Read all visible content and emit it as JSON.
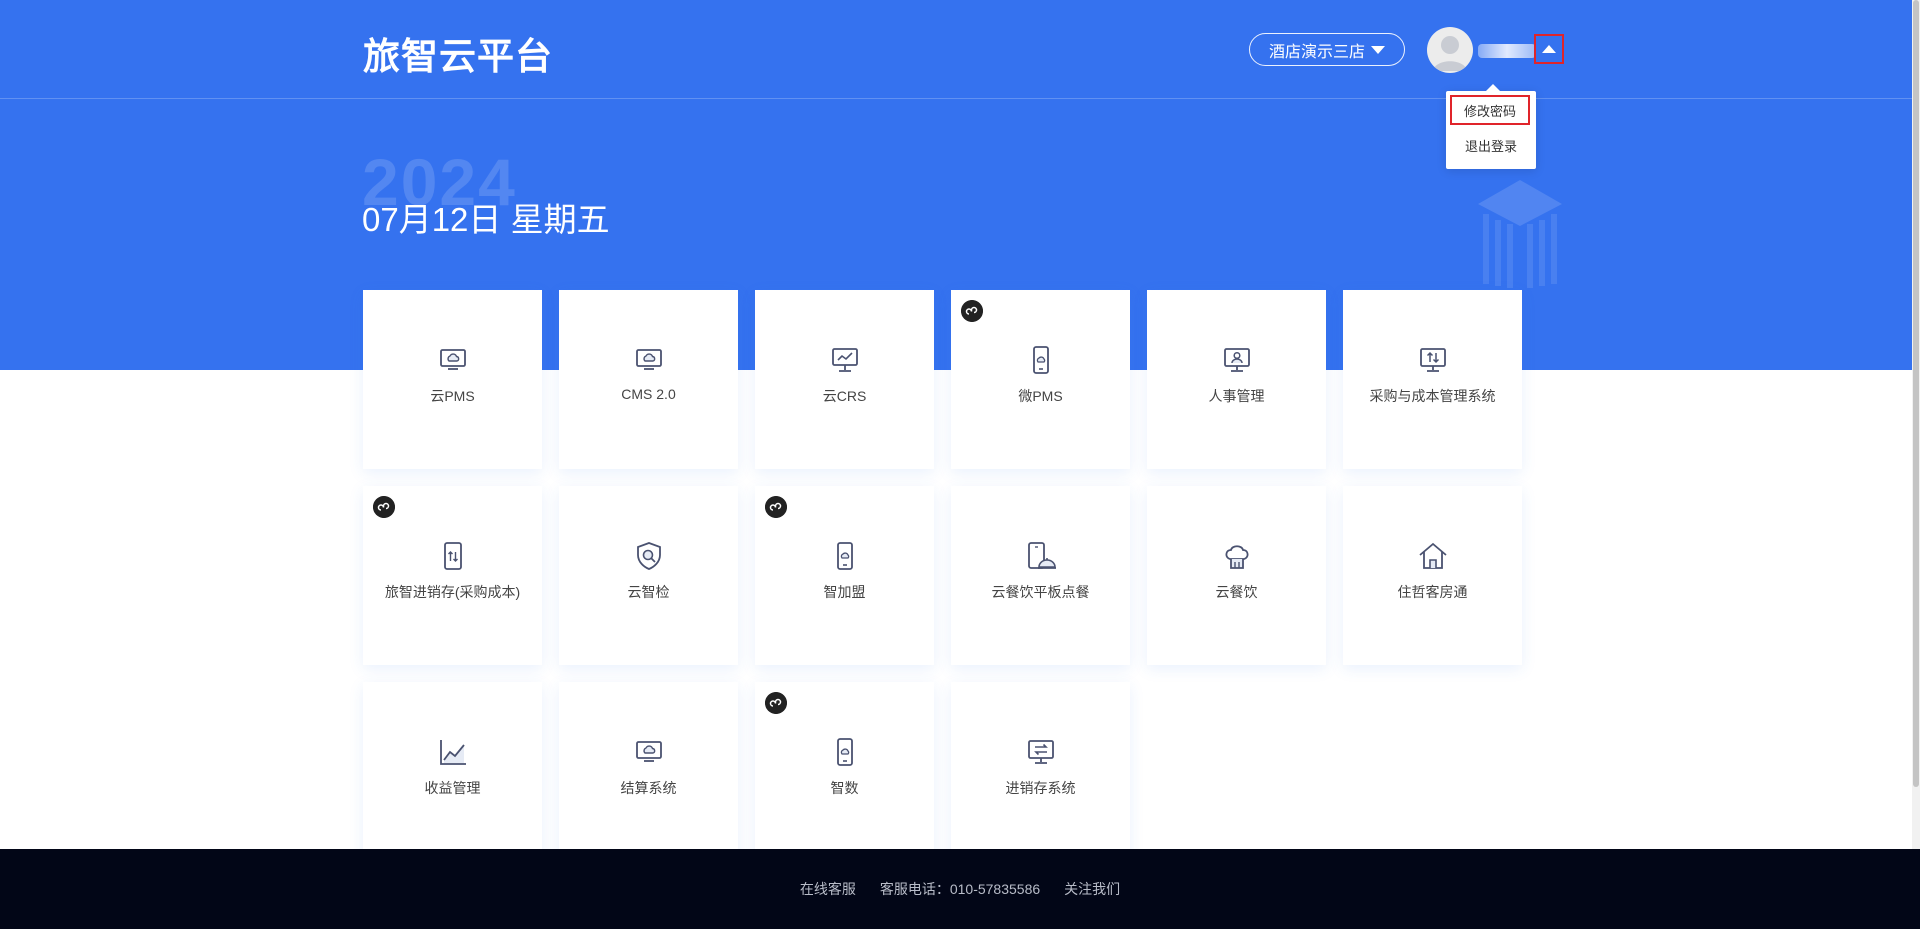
{
  "header": {
    "brand": "旅智云平台",
    "store": "酒店演示三店"
  },
  "user_menu": {
    "items": [
      "修改密码",
      "退出登录"
    ]
  },
  "hero": {
    "year": "2024",
    "date": "07月12日 星期五"
  },
  "apps": [
    {
      "label": "云PMS",
      "icon": "cloud-monitor-icon"
    },
    {
      "label": "CMS 2.0",
      "icon": "cloud-monitor-icon"
    },
    {
      "label": "云CRS",
      "icon": "chart-monitor-icon"
    },
    {
      "label": "微PMS",
      "icon": "cloud-phone-icon",
      "mini_program": true
    },
    {
      "label": "人事管理",
      "icon": "person-monitor-icon"
    },
    {
      "label": "采购与成本管理系统",
      "icon": "transfer-monitor-icon"
    },
    {
      "label": "旅智进销存(采购成本)",
      "icon": "transfer-phone-icon",
      "mini_program": true
    },
    {
      "label": "云智检",
      "icon": "shield-search-icon"
    },
    {
      "label": "智加盟",
      "icon": "cloud-phone-icon",
      "mini_program": true
    },
    {
      "label": "云餐饮平板点餐",
      "icon": "tablet-dish-icon"
    },
    {
      "label": "云餐饮",
      "icon": "chef-hat-icon"
    },
    {
      "label": "住哲客房通",
      "icon": "house-icon"
    },
    {
      "label": "收益管理",
      "icon": "trend-chart-icon"
    },
    {
      "label": "结算系统",
      "icon": "cloud-monitor-icon"
    },
    {
      "label": "智数",
      "icon": "cloud-phone-icon",
      "mini_program": true
    },
    {
      "label": "进销存系统",
      "icon": "exchange-monitor-icon"
    }
  ],
  "footer": {
    "online_service": "在线客服",
    "hotline": "客服电话：010-57835586",
    "follow": "关注我们"
  }
}
